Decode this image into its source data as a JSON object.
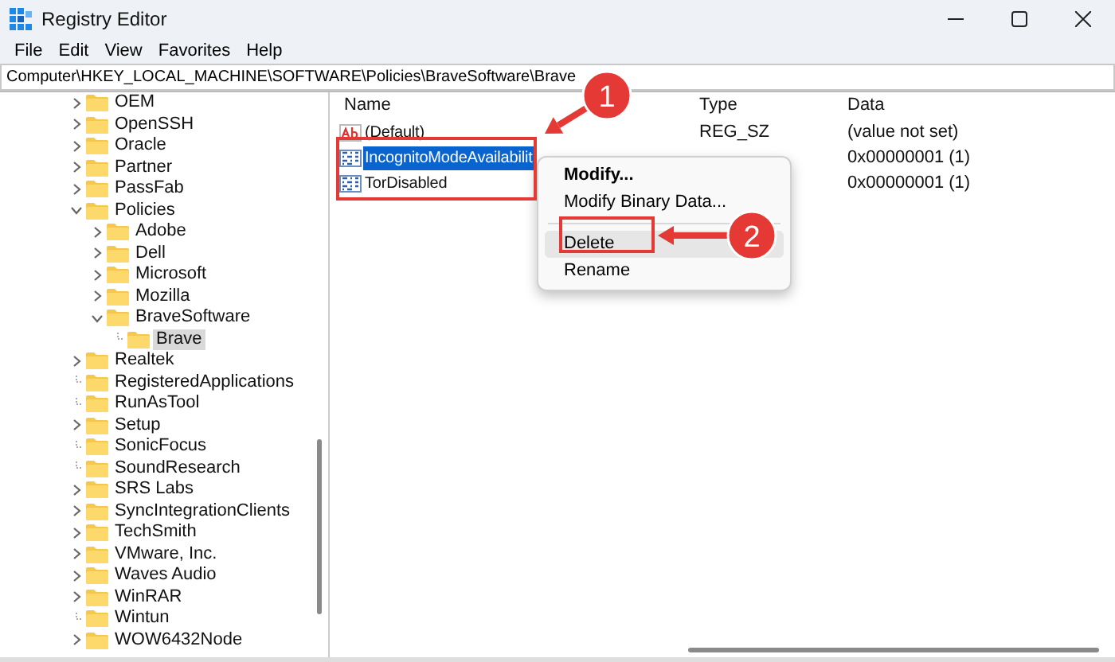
{
  "window": {
    "title": "Registry Editor"
  },
  "menu_bar": [
    "File",
    "Edit",
    "View",
    "Favorites",
    "Help"
  ],
  "address_bar": {
    "value": "Computer\\HKEY_LOCAL_MACHINE\\SOFTWARE\\Policies\\BraveSoftware\\Brave"
  },
  "tree": {
    "items": [
      {
        "label": "OEM",
        "kind": "collapsed",
        "selected": false
      },
      {
        "label": "OpenSSH",
        "kind": "collapsed",
        "selected": false
      },
      {
        "label": "Oracle",
        "kind": "collapsed",
        "selected": false
      },
      {
        "label": "Partner",
        "kind": "collapsed",
        "selected": false
      },
      {
        "label": "PassFab",
        "kind": "collapsed",
        "selected": false
      },
      {
        "label": "Policies",
        "kind": "expanded",
        "selected": false,
        "children": [
          {
            "label": "Adobe",
            "kind": "collapsed",
            "selected": false
          },
          {
            "label": "Dell",
            "kind": "collapsed",
            "selected": false
          },
          {
            "label": "Microsoft",
            "kind": "collapsed",
            "selected": false
          },
          {
            "label": "Mozilla",
            "kind": "collapsed",
            "selected": false
          },
          {
            "label": "BraveSoftware",
            "kind": "expanded",
            "selected": false,
            "children": [
              {
                "label": "Brave",
                "kind": "leaf",
                "selected": true
              }
            ]
          }
        ]
      },
      {
        "label": "Realtek",
        "kind": "collapsed",
        "selected": false
      },
      {
        "label": "RegisteredApplications",
        "kind": "leaf",
        "selected": false
      },
      {
        "label": "RunAsTool",
        "kind": "leaf",
        "selected": false
      },
      {
        "label": "Setup",
        "kind": "collapsed",
        "selected": false
      },
      {
        "label": "SonicFocus",
        "kind": "leaf",
        "selected": false
      },
      {
        "label": "SoundResearch",
        "kind": "leaf",
        "selected": false
      },
      {
        "label": "SRS Labs",
        "kind": "collapsed",
        "selected": false
      },
      {
        "label": "SyncIntegrationClients",
        "kind": "collapsed",
        "selected": false
      },
      {
        "label": "TechSmith",
        "kind": "collapsed",
        "selected": false
      },
      {
        "label": "VMware, Inc.",
        "kind": "collapsed",
        "selected": false
      },
      {
        "label": "Waves Audio",
        "kind": "collapsed",
        "selected": false
      },
      {
        "label": "WinRAR",
        "kind": "collapsed",
        "selected": false
      },
      {
        "label": "Wintun",
        "kind": "leaf",
        "selected": false
      },
      {
        "label": "WOW6432Node",
        "kind": "collapsed",
        "selected": false
      }
    ]
  },
  "values": {
    "columns": [
      "Name",
      "Type",
      "Data"
    ],
    "rows": [
      {
        "kind": "string",
        "name": "(Default)",
        "type": "REG_SZ",
        "data": "(value not set)",
        "selected": false
      },
      {
        "kind": "binary",
        "name": "IncognitoModeAvailabilit",
        "data": "0x00000001 (1)",
        "selected": true
      },
      {
        "kind": "binary",
        "name": "TorDisabled",
        "data": "0x00000001 (1)",
        "selected": false
      }
    ]
  },
  "context_menu": {
    "items": [
      {
        "kind": "item",
        "label": "Modify...",
        "default": true,
        "highlighted": false
      },
      {
        "kind": "item",
        "label": "Modify Binary Data...",
        "default": false,
        "highlighted": false
      },
      {
        "kind": "separator"
      },
      {
        "kind": "item",
        "label": "Delete",
        "default": false,
        "highlighted": true
      },
      {
        "kind": "item",
        "label": "Rename",
        "default": false,
        "highlighted": false
      }
    ]
  },
  "annotations": [
    {
      "label": "1"
    },
    {
      "label": "2"
    }
  ]
}
